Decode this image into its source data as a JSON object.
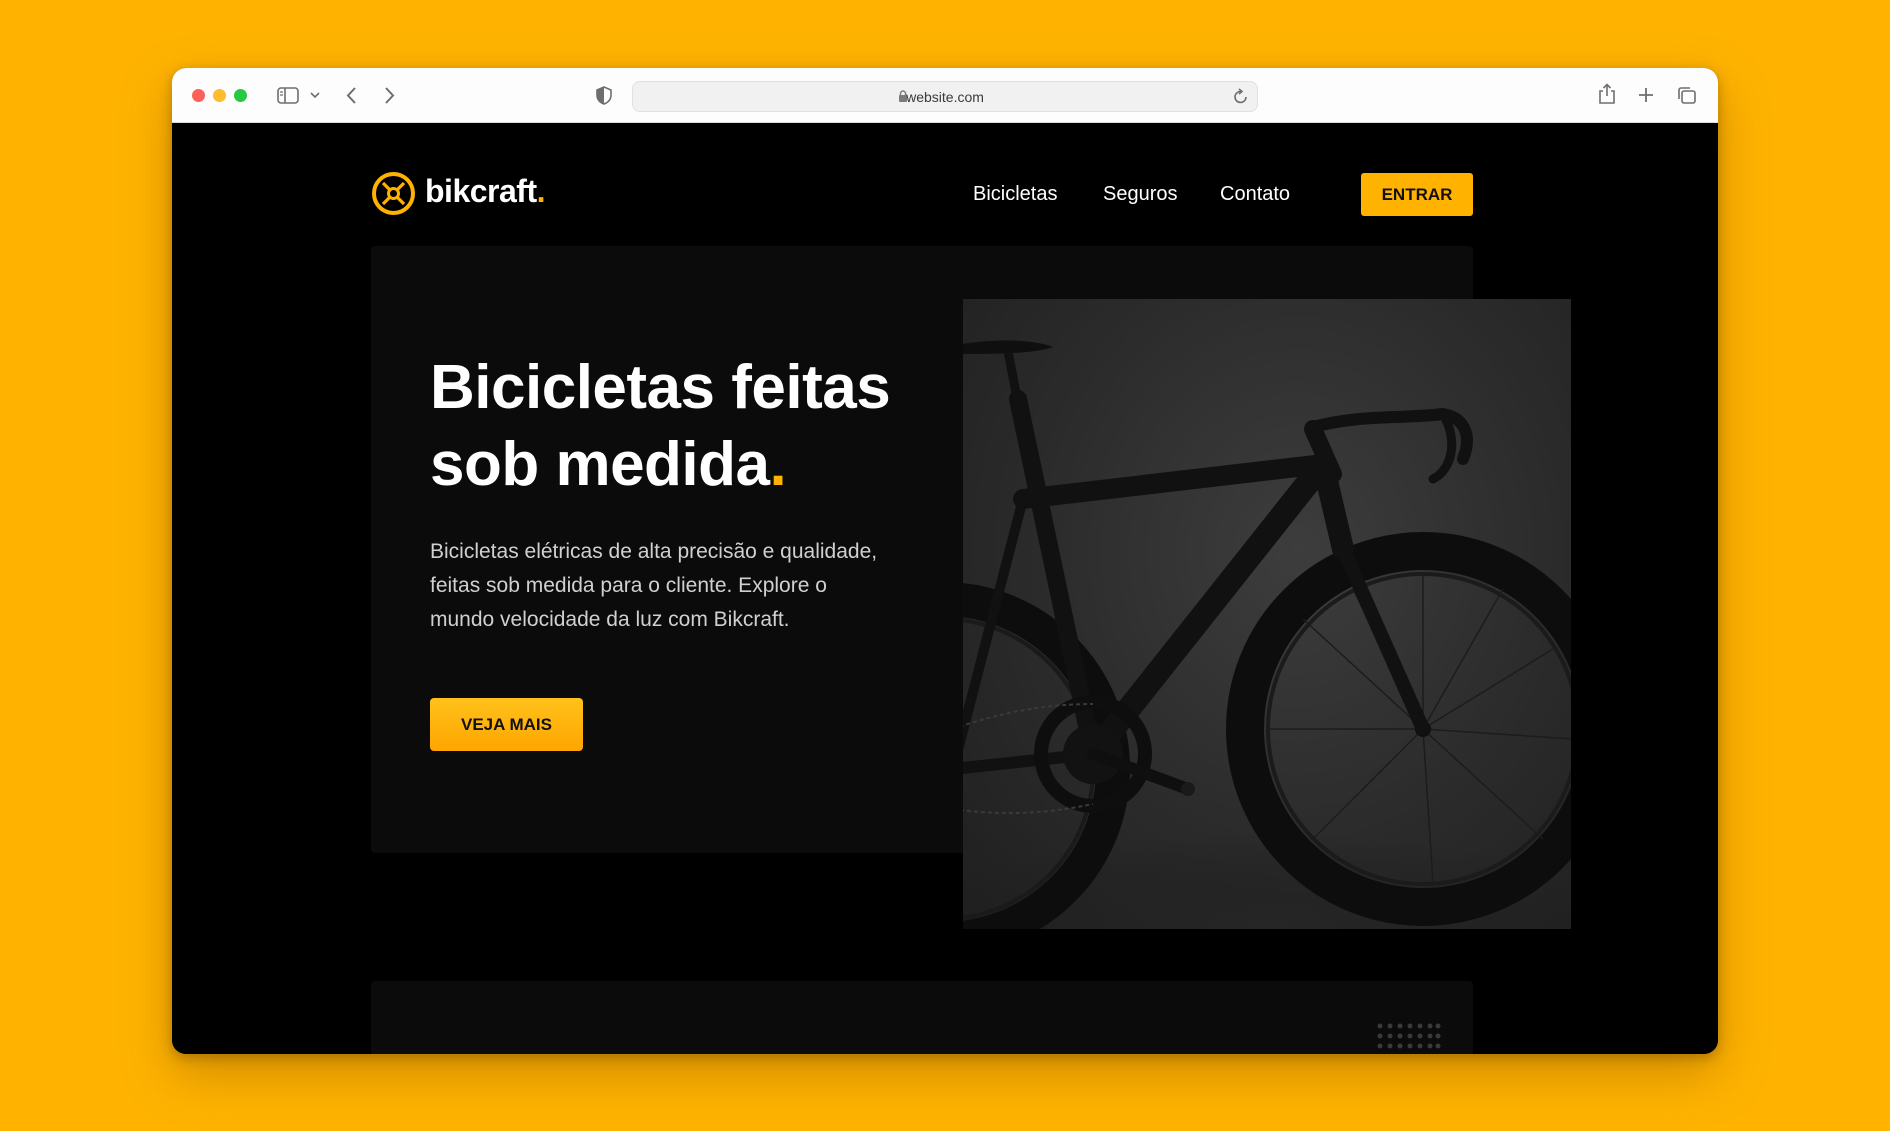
{
  "browser": {
    "url": "website.com",
    "icons": [
      "sidebar-icon",
      "chevron-down-icon",
      "back-icon",
      "forward-icon",
      "shield-icon",
      "lock-icon",
      "reload-icon",
      "share-icon",
      "new-tab-icon",
      "tabs-overview-icon"
    ]
  },
  "site": {
    "logo": {
      "name": "bikcraft",
      "dot": "."
    },
    "nav": [
      {
        "label": "Bicicletas"
      },
      {
        "label": "Seguros"
      },
      {
        "label": "Contato"
      }
    ],
    "login_label": "ENTRAR",
    "hero": {
      "title_line1": "Bicicletas feitas",
      "title_line2": "sob medida",
      "title_dot": ".",
      "text": "Bicicletas elétricas de alta precisão e qualidade, feitas sob medida para o cliente. Explore o mundo velocidade da luz com Bikcraft.",
      "cta_label": "VEJA MAIS"
    }
  },
  "colors": {
    "background": "#FFB300",
    "accent": "#FFB300",
    "site_bg": "#000000",
    "card_bg": "#0b0b0b"
  }
}
